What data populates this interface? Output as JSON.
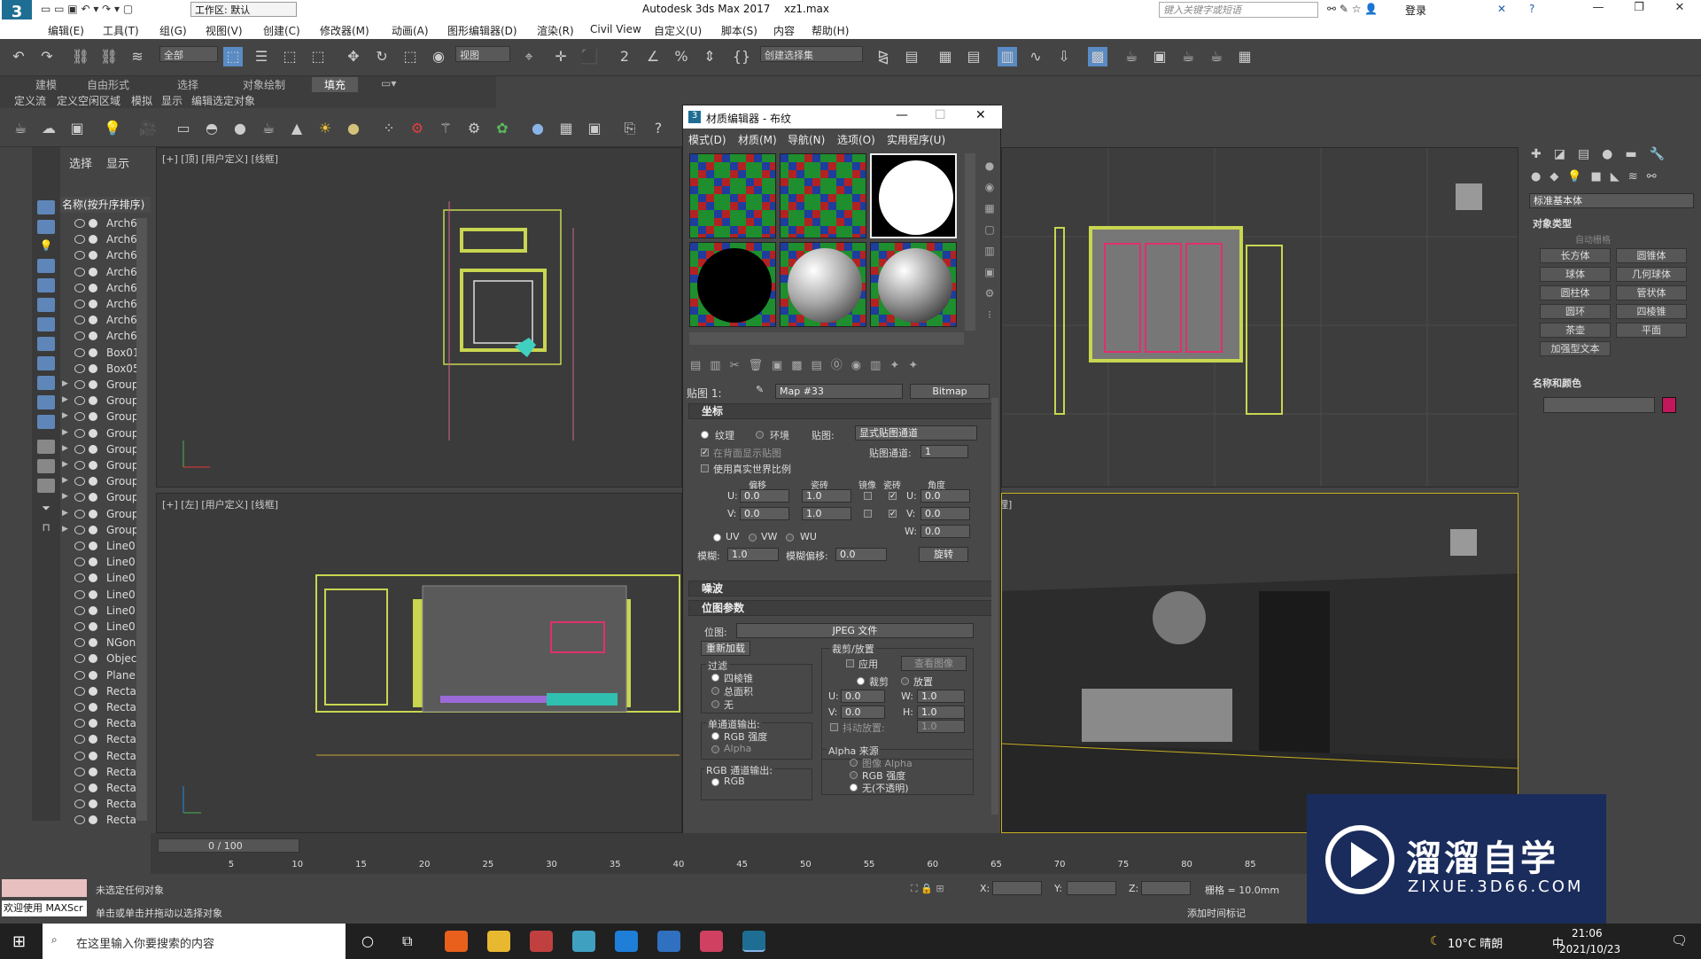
{
  "app": {
    "title": "Autodesk 3ds Max 2017",
    "file": "xz1.max",
    "workspace": "工作区: 默认",
    "search_placeholder": "键入关键字或短语",
    "login": "登录"
  },
  "menu": [
    "编辑(E)",
    "工具(T)",
    "组(G)",
    "视图(V)",
    "创建(C)",
    "修改器(M)",
    "动画(A)",
    "图形编辑器(D)",
    "渲染(R)",
    "Civil View",
    "自定义(U)",
    "脚本(S)",
    "内容",
    "帮助(H)"
  ],
  "toolbar": {
    "filter": "全部",
    "view": "视图",
    "selection_set": "创建选择集"
  },
  "ribbon": {
    "tabs": [
      "建模",
      "自由形式",
      "选择",
      "对象绘制",
      "填充"
    ],
    "sub": [
      "定义流",
      "定义空闲区域",
      "模拟",
      "显示",
      "编辑选定对象"
    ]
  },
  "scene_explorer": {
    "tabs": [
      "选择",
      "显示"
    ],
    "column": "名称(按升序排序)",
    "items": [
      {
        "name": "Arch6",
        "expand": false
      },
      {
        "name": "Arch6",
        "expand": false
      },
      {
        "name": "Arch6",
        "expand": false
      },
      {
        "name": "Arch6",
        "expand": false
      },
      {
        "name": "Arch6",
        "expand": false
      },
      {
        "name": "Arch6",
        "expand": false
      },
      {
        "name": "Arch6",
        "expand": false
      },
      {
        "name": "Arch6",
        "expand": false
      },
      {
        "name": "Box01",
        "expand": false
      },
      {
        "name": "Box05",
        "expand": false
      },
      {
        "name": "Group",
        "expand": true
      },
      {
        "name": "Group",
        "expand": true
      },
      {
        "name": "Group",
        "expand": true
      },
      {
        "name": "Group",
        "expand": true
      },
      {
        "name": "Group",
        "expand": true
      },
      {
        "name": "Group",
        "expand": true
      },
      {
        "name": "Group",
        "expand": true
      },
      {
        "name": "Group",
        "expand": true
      },
      {
        "name": "Group",
        "expand": true
      },
      {
        "name": "Group",
        "expand": true
      },
      {
        "name": "Line0",
        "expand": false
      },
      {
        "name": "Line0",
        "expand": false
      },
      {
        "name": "Line0",
        "expand": false
      },
      {
        "name": "Line0",
        "expand": false
      },
      {
        "name": "Line0",
        "expand": false
      },
      {
        "name": "Line0",
        "expand": false
      },
      {
        "name": "NGon",
        "expand": false
      },
      {
        "name": "Objec",
        "expand": false
      },
      {
        "name": "Plane",
        "expand": false
      },
      {
        "name": "Recta",
        "expand": false
      },
      {
        "name": "Recta",
        "expand": false
      },
      {
        "name": "Recta",
        "expand": false
      },
      {
        "name": "Recta",
        "expand": false
      },
      {
        "name": "Recta",
        "expand": false
      },
      {
        "name": "Recta",
        "expand": false
      },
      {
        "name": "Recta",
        "expand": false
      },
      {
        "name": "Recta",
        "expand": false
      },
      {
        "name": "Recta",
        "expand": false
      }
    ]
  },
  "viewports": {
    "top": "[+] [顶] [用户定义] [线框]",
    "left": "[+] [左] [用户定义] [线框]",
    "persp_suffix": "理]"
  },
  "material_editor": {
    "title": "材质编辑器 - 布纹",
    "menus": [
      "模式(D)",
      "材质(M)",
      "导航(N)",
      "选项(O)",
      "实用程序(U)"
    ],
    "map_label": "贴图 1:",
    "map_name": "Map #33",
    "map_type": "Bitmap",
    "coords": {
      "header": "坐标",
      "texture": "纹理",
      "environ": "环境",
      "mapping_label": "贴图:",
      "mapping_value": "显式贴图通道",
      "show_on_back": "在背面显示贴图",
      "map_channel_label": "贴图通道:",
      "map_channel": "1",
      "real_world": "使用真实世界比例",
      "offset": "偏移",
      "tiling": "瓷砖",
      "mirror": "镜像",
      "tile": "瓷砖",
      "angle": "角度",
      "u_offset": "0.0",
      "v_offset": "0.0",
      "u_tiling": "1.0",
      "v_tiling": "1.0",
      "u_angle": "0.0",
      "v_angle": "0.0",
      "w_angle": "0.0",
      "uv": "UV",
      "vw": "VW",
      "wu": "WU",
      "blur_label": "模糊:",
      "blur": "1.0",
      "blur_offset_label": "模糊偏移:",
      "blur_offset": "0.0",
      "rotate": "旋转"
    },
    "noise_header": "噪波",
    "bitmap": {
      "header": "位图参数",
      "bitmap_label": "位图:",
      "bitmap_value": "JPEG 文件",
      "reload": "重新加载",
      "crop_title": "裁剪/放置",
      "apply": "应用",
      "view_image": "查看图像",
      "crop": "裁剪",
      "place": "放置",
      "u": "0.0",
      "w": "1.0",
      "v": "0.0",
      "h": "1.0",
      "jitter": "抖动放置:",
      "jitter_val": "1.0",
      "filter_title": "过滤",
      "filter_opts": [
        "四棱锥",
        "总面积",
        "无"
      ],
      "mono_title": "单通道输出:",
      "mono_opts": [
        "RGB 强度",
        "Alpha"
      ],
      "rgb_title": "RGB 通道输出:",
      "rgb_opt": "RGB",
      "alpha_title": "Alpha 来源",
      "alpha_opts": [
        "图像 Alpha",
        "RGB 强度",
        "无(不透明)"
      ]
    }
  },
  "command_panel": {
    "dropdown": "标准基本体",
    "object_type": "对象类型",
    "autogrid": "自动栅格",
    "buttons": [
      "长方体",
      "圆锥体",
      "球体",
      "几何球体",
      "圆柱体",
      "管状体",
      "圆环",
      "四棱锥",
      "茶壶",
      "平面",
      "加强型文本"
    ],
    "name_color": "名称和颜色",
    "color": "#c2185b"
  },
  "timeline": {
    "frame": "0 / 100",
    "ticks": [
      "5",
      "10",
      "15",
      "20",
      "25",
      "30",
      "35",
      "40",
      "45",
      "50",
      "55",
      "60",
      "65",
      "70",
      "75",
      "80",
      "85"
    ]
  },
  "status": {
    "welcome": "欢迎使用 MAXScr",
    "msg1": "未选定任何对象",
    "msg2": "单击或单击并拖动以选择对象",
    "x": "X:",
    "y": "Y:",
    "z": "Z:",
    "grid": "栅格 = 10.0mm",
    "add_time_tag": "添加时间标记"
  },
  "taskbar": {
    "search": "在这里输入你要搜索的内容",
    "weather": "10°C 晴朗",
    "ime": "中",
    "time": "21:06",
    "date": "2021/10/23"
  },
  "watermark": {
    "title": "溜溜自学",
    "url": "ZIXUE.3D66.COM"
  }
}
